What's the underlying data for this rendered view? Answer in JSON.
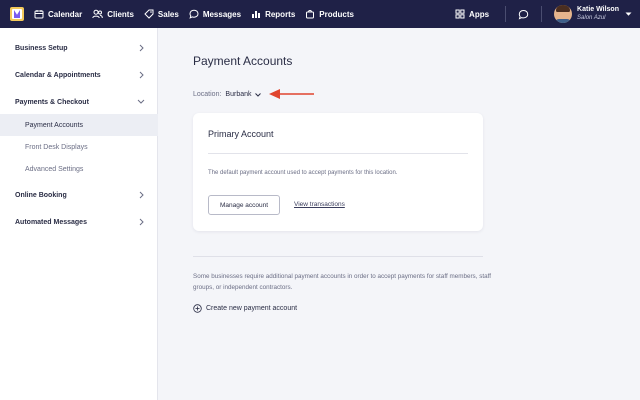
{
  "nav": {
    "items": [
      {
        "label": "Calendar",
        "icon": "calendar-icon"
      },
      {
        "label": "Clients",
        "icon": "clients-icon"
      },
      {
        "label": "Sales",
        "icon": "tag-icon"
      },
      {
        "label": "Messages",
        "icon": "chat-icon"
      },
      {
        "label": "Reports",
        "icon": "bar-chart-icon"
      },
      {
        "label": "Products",
        "icon": "bag-icon"
      }
    ],
    "apps_label": "Apps",
    "user_name": "Katie Wilson",
    "user_salon": "Salon Azul"
  },
  "sidebar": {
    "items": [
      {
        "label": "Business Setup"
      },
      {
        "label": "Calendar & Appointments"
      },
      {
        "label": "Payments & Checkout"
      },
      {
        "label": "Payment Accounts"
      },
      {
        "label": "Front Desk Displays"
      },
      {
        "label": "Advanced Settings"
      },
      {
        "label": "Online Booking"
      },
      {
        "label": "Automated Messages"
      }
    ]
  },
  "main": {
    "title": "Payment Accounts",
    "location_label": "Location:",
    "location_value": "Burbank",
    "card": {
      "title": "Primary Account",
      "description": "The default payment account used to accept payments for this location.",
      "manage_label": "Manage account",
      "view_label": "View transactions"
    },
    "note": "Some businesses require additional payment accounts in order to accept payments for staff members, staff groups, or independent contractors.",
    "create_label": "Create new payment account"
  },
  "colors": {
    "nav_bg": "#1f2147",
    "accent_arrow": "#e0452f",
    "page_bg": "#f4f5f9"
  }
}
